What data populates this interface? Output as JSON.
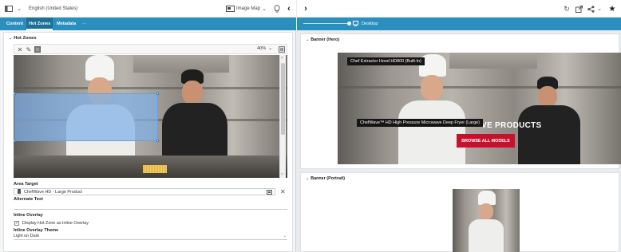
{
  "left_toolbar": {
    "locale": "English (United States)",
    "component": "Image Map"
  },
  "tabs": [
    {
      "label": "Content",
      "active": false
    },
    {
      "label": "Hot Zones",
      "active": true
    },
    {
      "label": "Metadata",
      "active": false
    },
    {
      "label": "···",
      "active": false
    }
  ],
  "hot_zones": {
    "section_title": "Hot Zones",
    "zoom": "40%"
  },
  "fields": {
    "area_target_label": "Area Target",
    "area_target_value": "ChefWave HD - Large Product",
    "alternate_text_label": "Alternate Text",
    "alternate_text_value": "",
    "inline_overlay_label": "Inline Overlay",
    "inline_overlay_checkbox_label": "Display Hot Zone as Inline Overlay",
    "inline_overlay_checked": true,
    "inline_overlay_theme_label": "Inline Overlay Theme",
    "inline_overlay_theme_value": "Light on Dark"
  },
  "right_toolbar": {
    "device": "Desktop"
  },
  "preview": {
    "banner_hero_title": "Banner (Hero)",
    "tooltip_top": "Chef Extractor Hood HD800 (Built-In)",
    "tooltip_middle": "ChefWave™ HD High Pressure Microwave Deep Fryer (Large)",
    "headline": "VE PRODUCTS",
    "cta": "BROWSE ALL MODELS",
    "banner_portrait_title": "Banner (Portrait)"
  }
}
